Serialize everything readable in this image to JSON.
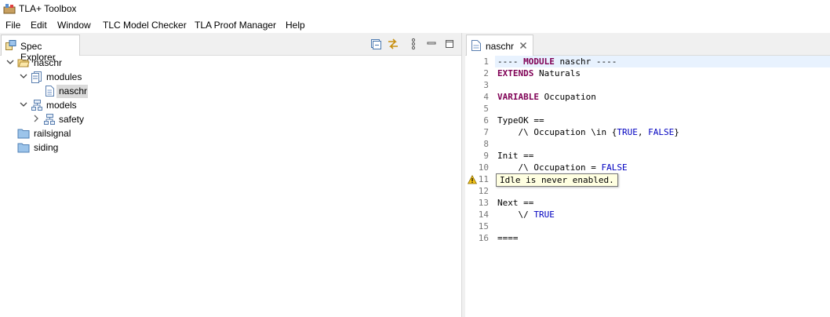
{
  "window": {
    "title": "TLA+ Toolbox"
  },
  "menu": [
    "File",
    "Edit",
    "Window",
    "TLC Model Checker",
    "TLA Proof Manager",
    "Help"
  ],
  "spec_explorer": {
    "tab_label": "Spec Explorer",
    "tree": {
      "root": "naschr",
      "modules": "modules",
      "module_file": "naschr",
      "models": "models",
      "model_safety": "safety",
      "railsignal": "railsignal",
      "siding": "siding"
    }
  },
  "editor": {
    "tab_label": "naschr",
    "line_numbers": [
      "1",
      "2",
      "3",
      "4",
      "5",
      "6",
      "7",
      "8",
      "9",
      "10",
      "11",
      "12",
      "13",
      "14",
      "15",
      "16"
    ],
    "lines": {
      "l1_a": "---- ",
      "l1_kw": "MODULE",
      "l1_b": " naschr ----",
      "l2_kw": "EXTENDS",
      "l2_b": " Naturals",
      "l4_kw": "VARIABLE",
      "l4_b": " Occupation",
      "l6": "TypeOK ==",
      "l7_a": "    /\\ Occupation \\in {",
      "l7_t": "TRUE",
      "l7_c": ", ",
      "l7_f": "FALSE",
      "l7_d": "}",
      "l9": "Init ==",
      "l10_a": "    /\\ Occupation = ",
      "l10_f": "FALSE",
      "l13": "Next ==",
      "l14_a": "    \\/ ",
      "l14_t": "TRUE",
      "l16": "===="
    },
    "tooltip": "Idle is never enabled.",
    "colors": {
      "keyword": "#7f0055",
      "builtin": "#0000c0",
      "current_line": "#e8f2fe"
    }
  }
}
